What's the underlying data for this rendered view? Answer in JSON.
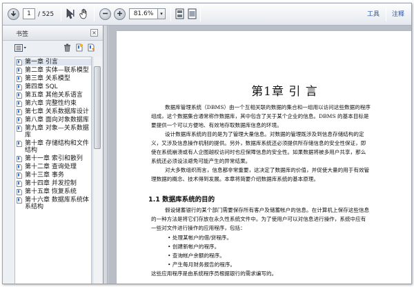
{
  "toolbar": {
    "page_current": "1",
    "page_total": "/ 525",
    "zoom": "81.6%",
    "tools_label": "工具",
    "comment_label": "注释"
  },
  "sidebar": {
    "title": "书签",
    "close": "×",
    "bookmarks": [
      "第一章 引言",
      "第二章 实体—联系模型",
      "第三章 关系模型",
      "第四章 SQL",
      "第五章 其他关系语言",
      "第六章 完整性约束",
      "第七章 关系数据库设计",
      "第八章 面向对象数据库",
      "第九章 对象—关系数据库",
      "第十章 存储结构和文件结构",
      "第十一章 索引和散列",
      "第十二章 查询处理",
      "第十三章 事务",
      "第十四章 并发控制",
      "第十五章 恢复系统",
      "第十六章 数据库系统体系结构"
    ]
  },
  "document": {
    "chapter_title": "第1章  引    言",
    "intro_lines": [
      "数据库管理系统（DBMS）由一个互相关联的数据的集合和一组用以访问这些数据的程序",
      "组成，这个数据集合通常称作数据库，其中包含了关于某个企业的信息。DBMS 的基本目标是",
      "要提供一个可以方便地、有效地存取数据库信息的环境。"
    ],
    "para2_lines": [
      "设计数据库系统的目的是为了管理大量信息。对数据的管理既涉及到信息存储结构的定",
      "义，又涉及信息操作机制的提供。另外，数据库系统还必须提供所存储信息的安全性保证，即",
      "使在系统崩溃或有人企图越权访问时也应保障信息的安全性。如果数据将被多用户共享，那么",
      "系统还必须设法避免可能产生的异常结果。"
    ],
    "para3_lines": [
      "对大多数组织而言，信息都非常重要，这决定了数据库的价值，并促使大量的用于有效管",
      "理数据的概念、技术得到发展。本章将简要介绍数据库系统的基本原理。"
    ],
    "section_title": "1.1  数据库系统的目的",
    "para4_lines": [
      "假设储蓄银行的某个部门需要保存所有客户及储蓄帐户的信息。在计算机上保存这些信息",
      "的一种方法是将它们存放在永久性系统文件中。为了使用户可以对信息进行操作，系统中应有",
      "一些对文件进行操作的应用程序，包括："
    ],
    "bullets": [
      "• 处理某帐户的借/贷程序。",
      "• 创建新帐户的程序。",
      "• 查询帐户余额的程序。",
      "• 产生每月财务报告的程序。"
    ],
    "tail_line": "这些应用程序是由系统程序员根据银行的需求编写的。"
  }
}
